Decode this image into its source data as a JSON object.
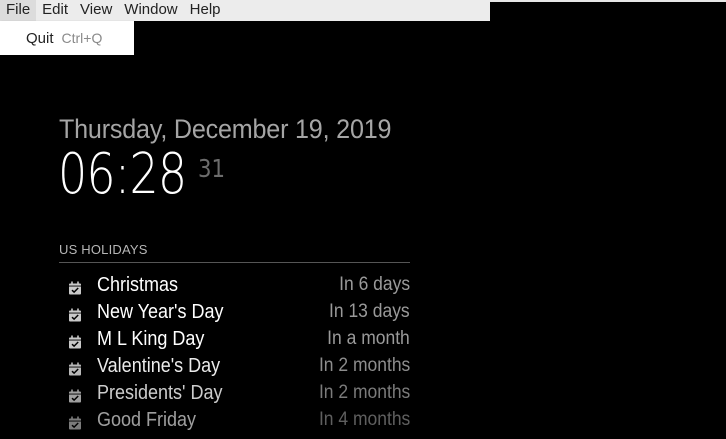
{
  "menubar": {
    "items": [
      {
        "label": "File",
        "active": true
      },
      {
        "label": "Edit"
      },
      {
        "label": "View"
      },
      {
        "label": "Window"
      },
      {
        "label": "Help"
      }
    ]
  },
  "file_menu": {
    "items": [
      {
        "label": "Quit",
        "shortcut": "Ctrl+Q"
      }
    ]
  },
  "clock": {
    "date": "Thursday, December 19, 2019",
    "time": "06:28",
    "seconds": "31"
  },
  "holidays": {
    "title": "US HOLIDAYS",
    "icon": "calendar-check-icon",
    "events": [
      {
        "name": "Christmas",
        "when": "In 6 days",
        "opacity": 1.0
      },
      {
        "name": "New Year's Day",
        "when": "In 13 days",
        "opacity": 1.0
      },
      {
        "name": "M L King Day",
        "when": "In a month",
        "opacity": 1.0
      },
      {
        "name": "Valentine's Day",
        "when": "In 2 months",
        "opacity": 0.92
      },
      {
        "name": "Presidents' Day",
        "when": "In 2 months",
        "opacity": 0.8
      },
      {
        "name": "Good Friday",
        "when": "In 4 months",
        "opacity": 0.62
      }
    ]
  },
  "colors": {
    "background": "#000000",
    "menubar": "#ececec",
    "date_text": "#a5a5a5",
    "time_text": "#ffffff",
    "seconds_text": "#6c6c6c",
    "event_name": "#ffffff",
    "event_when": "#9a9a9a"
  }
}
